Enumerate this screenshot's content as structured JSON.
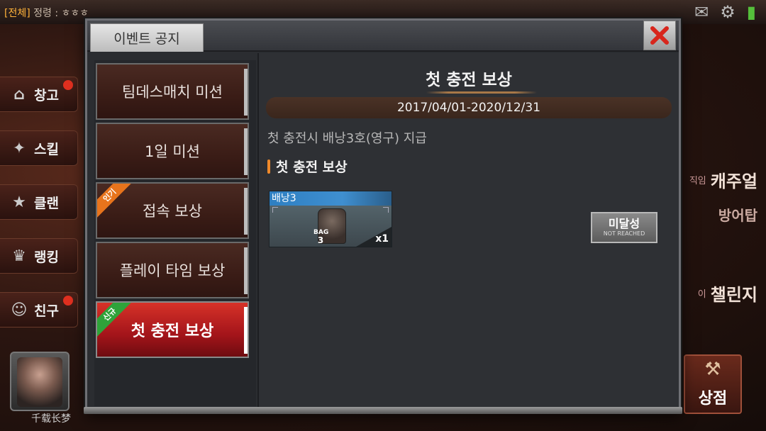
{
  "background": {
    "chat_tag": "[전체]",
    "chat_text": "정령 : ㅎㅎㅎ",
    "left_menu": [
      {
        "label": "창고",
        "icon": "warehouse-icon",
        "badge": true
      },
      {
        "label": "스킬",
        "icon": "skill-icon",
        "badge": false
      },
      {
        "label": "클랜",
        "icon": "clan-icon",
        "badge": false
      },
      {
        "label": "랭킹",
        "icon": "ranking-icon",
        "badge": false
      },
      {
        "label": "친구",
        "icon": "friend-icon",
        "badge": true
      }
    ],
    "right_menu": [
      {
        "small": "직임",
        "label": "캐주얼"
      },
      {
        "small": "",
        "label": "방어탑"
      },
      {
        "small": "이",
        "label": "챌린지"
      }
    ],
    "shop_label": "상점",
    "player_name": "千载长梦"
  },
  "modal": {
    "title": "이벤트 공지",
    "tabs": [
      {
        "label": "팀데스매치 미션",
        "ribbon": "",
        "active": false
      },
      {
        "label": "1일 미션",
        "ribbon": "",
        "active": false
      },
      {
        "label": "접속 보상",
        "ribbon": "인기",
        "active": false
      },
      {
        "label": "플레이 타임 보상",
        "ribbon": "",
        "active": false
      },
      {
        "label": "첫 충전 보상",
        "ribbon": "신규",
        "active": true
      }
    ],
    "content": {
      "title": "첫 충전 보상",
      "date_range": "2017/04/01-2020/12/31",
      "description": "첫 충전시 배낭3호(영구) 지급",
      "section_heading": "첫 충전 보상",
      "reward": {
        "name": "배낭3",
        "bag_label_top": "BAG",
        "bag_label_num": "3",
        "quantity": "x1"
      },
      "status": {
        "main": "미달성",
        "sub": "NOT REACHED"
      }
    }
  },
  "colors": {
    "active_tab": "#c8242a",
    "accent_orange": "#f08a2a",
    "reward_name_bar": "#3f8fd0"
  }
}
